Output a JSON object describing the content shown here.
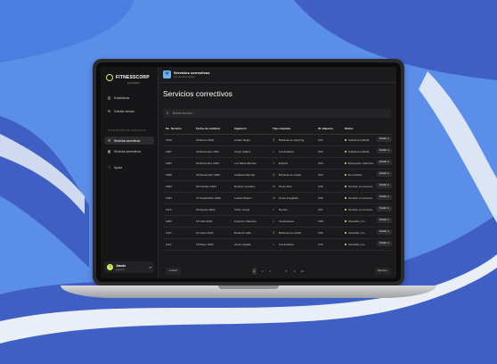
{
  "app": {
    "logo_text": "FITNESSCORP",
    "logo_sub": "EQUIPMENT"
  },
  "sidebar": {
    "items": [
      {
        "label": "Estadísticas",
        "icon": "bar-chart-icon"
      },
      {
        "label": "Solicitar servicio",
        "icon": "gear-icon"
      }
    ],
    "section_title": "CATEGORÍAS DE SERVICIOS",
    "section_items": [
      {
        "label": "Servicios correctivos",
        "icon": "wrench-icon",
        "active": true
      },
      {
        "label": "Servicios preventivos",
        "icon": "calendar-icon"
      }
    ],
    "bottom_items": [
      {
        "label": "Ayuda",
        "icon": "help-icon"
      }
    ],
    "user": {
      "initial": "J",
      "name": "Jeando",
      "role": "Ingeniero"
    }
  },
  "header": {
    "title": "Servicios correctivos",
    "subtitle": "Ver servicios activos"
  },
  "page_title": "Servicios correctivos",
  "search": {
    "placeholder": "Buscar servicio..."
  },
  "table": {
    "columns": [
      "No. Servicio",
      "Fecha de solicitud",
      "Ingeniero",
      "Tipo máquina",
      "ID máquina",
      "Status"
    ],
    "action_label": "Detalle",
    "rows": [
      {
        "id": "1870",
        "date": "23 Enero 2022",
        "engineer": "Adrián Rojas",
        "machine": "Bicicleta de spinning",
        "machine_id": "C01",
        "status": "Solicitud recibida"
      },
      {
        "id": "1867",
        "date": "29 Diciembre 2022",
        "engineer": "Oscar Ibáñez",
        "machine": "Caminadora",
        "machine_id": "C02",
        "status": "Solicitud recibida"
      },
      {
        "id": "1851",
        "date": "02 Diciembre 2022",
        "engineer": "Luz María Benitez",
        "machine": "Elíptica",
        "machine_id": "C03",
        "status": "Esperando refacción"
      },
      {
        "id": "1846",
        "date": "30 Noviembre 2022",
        "engineer": "Catalina Monsalt",
        "machine": "Bicicleta de cardio",
        "machine_id": "C04",
        "status": "En revisión"
      },
      {
        "id": "1833",
        "date": "09 Octubre 2021",
        "engineer": "Roberto Camara",
        "machine": "Press libre",
        "machine_id": "C05",
        "status": "Servicio en proceso"
      },
      {
        "id": "1821",
        "date": "27 Septiembre 2022",
        "engineer": "Leticia Ricaon",
        "machine": "Press integrada",
        "machine_id": "C06",
        "status": "Servicio en proceso"
      },
      {
        "id": "1115",
        "date": "09 Agosto 2022",
        "engineer": "Víctor Limas",
        "machine": "Remos",
        "machine_id": "C07",
        "status": "Servicio en proceso"
      },
      {
        "id": "1081",
        "date": "15 Julio 2022",
        "engineer": "Federico Valencia",
        "machine": "Caminadora",
        "machine_id": "C08",
        "status": "Atendido y fu..."
      },
      {
        "id": "1114",
        "date": "22 Junio 2022",
        "engineer": "Rolando Valle",
        "machine": "Bicicleta de cardio",
        "machine_id": "C09",
        "status": "Atendido y fu..."
      },
      {
        "id": "1112",
        "date": "19 Mayo 2022",
        "engineer": "Jesús Ugalde",
        "machine": "Caminadora",
        "machine_id": "C10",
        "status": "Atendido y fu..."
      }
    ]
  },
  "pagination": {
    "prev": "Anterior",
    "next": "Siguiente",
    "pages": [
      "1",
      "2",
      "3",
      "...",
      "8",
      "9",
      "10"
    ],
    "current": "1"
  }
}
